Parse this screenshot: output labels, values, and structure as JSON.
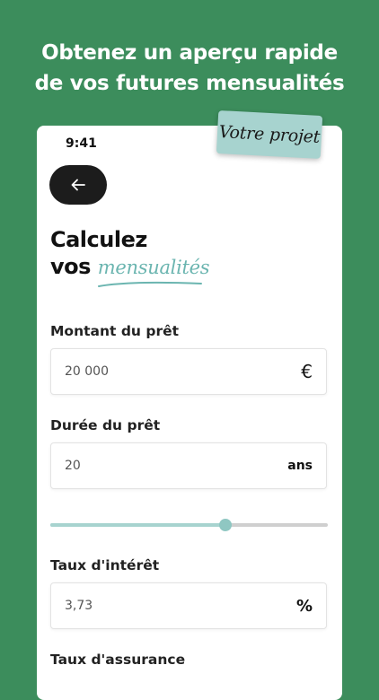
{
  "headline": {
    "line1": "Obtenez un aperçu rapide",
    "line2": "de vos futures mensualités"
  },
  "status": {
    "time": "9:41"
  },
  "sticker": {
    "label": "Votre projet"
  },
  "title": {
    "line1": "Calculez",
    "line2_prefix": "vos",
    "line2_accent": "mensualités"
  },
  "fields": {
    "amount": {
      "label": "Montant du prêt",
      "value": "20 000",
      "suffix": "€"
    },
    "duration": {
      "label": "Durée du prêt",
      "value": "20",
      "suffix": "ans"
    },
    "rate": {
      "label": "Taux d'intérêt",
      "value": "3,73",
      "suffix": "%"
    },
    "insurance": {
      "label": "Taux d'assurance"
    }
  },
  "duration_slider": {
    "fraction": 0.63
  },
  "colors": {
    "background": "#3c8d5c",
    "accent": "#6bb5b0",
    "sticker": "#a7d3cf",
    "button": "#1c1c1c"
  },
  "icons": {
    "back": "arrow-left-icon",
    "currency": "euro-icon",
    "percent": "percent-icon"
  }
}
